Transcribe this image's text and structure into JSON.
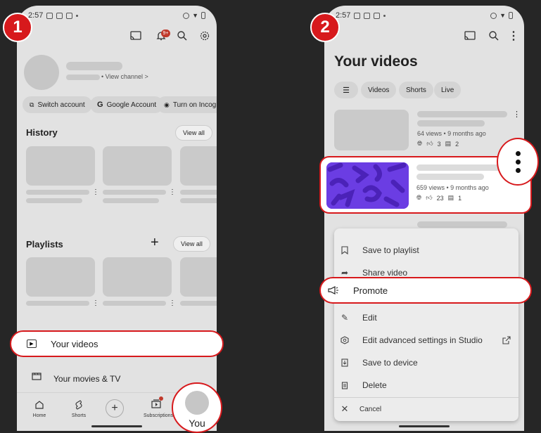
{
  "panel1": {
    "badge": "1",
    "status_time": "2:57",
    "notif_count": "9+",
    "view_channel": "• View channel >",
    "chips": [
      "Switch account",
      "Google Account",
      "Turn on Incognito"
    ],
    "history_title": "History",
    "view_all": "View all",
    "playlists_title": "Playlists",
    "playlists_view_all": "View all",
    "your_videos": "Your videos",
    "your_movies": "Your movies & TV",
    "nav": [
      "Home",
      "Shorts",
      "Subscriptions"
    ],
    "you_label": "You"
  },
  "panel2": {
    "badge": "2",
    "status_time": "2:57",
    "title": "Your videos",
    "filter_chips": [
      "Videos",
      "Shorts",
      "Live"
    ],
    "video1": {
      "stats": "64 views • 9 months ago",
      "likes": "3",
      "comments": "2"
    },
    "video2": {
      "stats": "659 views • 9 months ago",
      "likes": "23",
      "comments": "1"
    },
    "menu": [
      "Save to playlist",
      "Share video",
      "Promote",
      "Edit",
      "Edit advanced settings in Studio",
      "Save to device",
      "Delete",
      "Cancel"
    ]
  }
}
